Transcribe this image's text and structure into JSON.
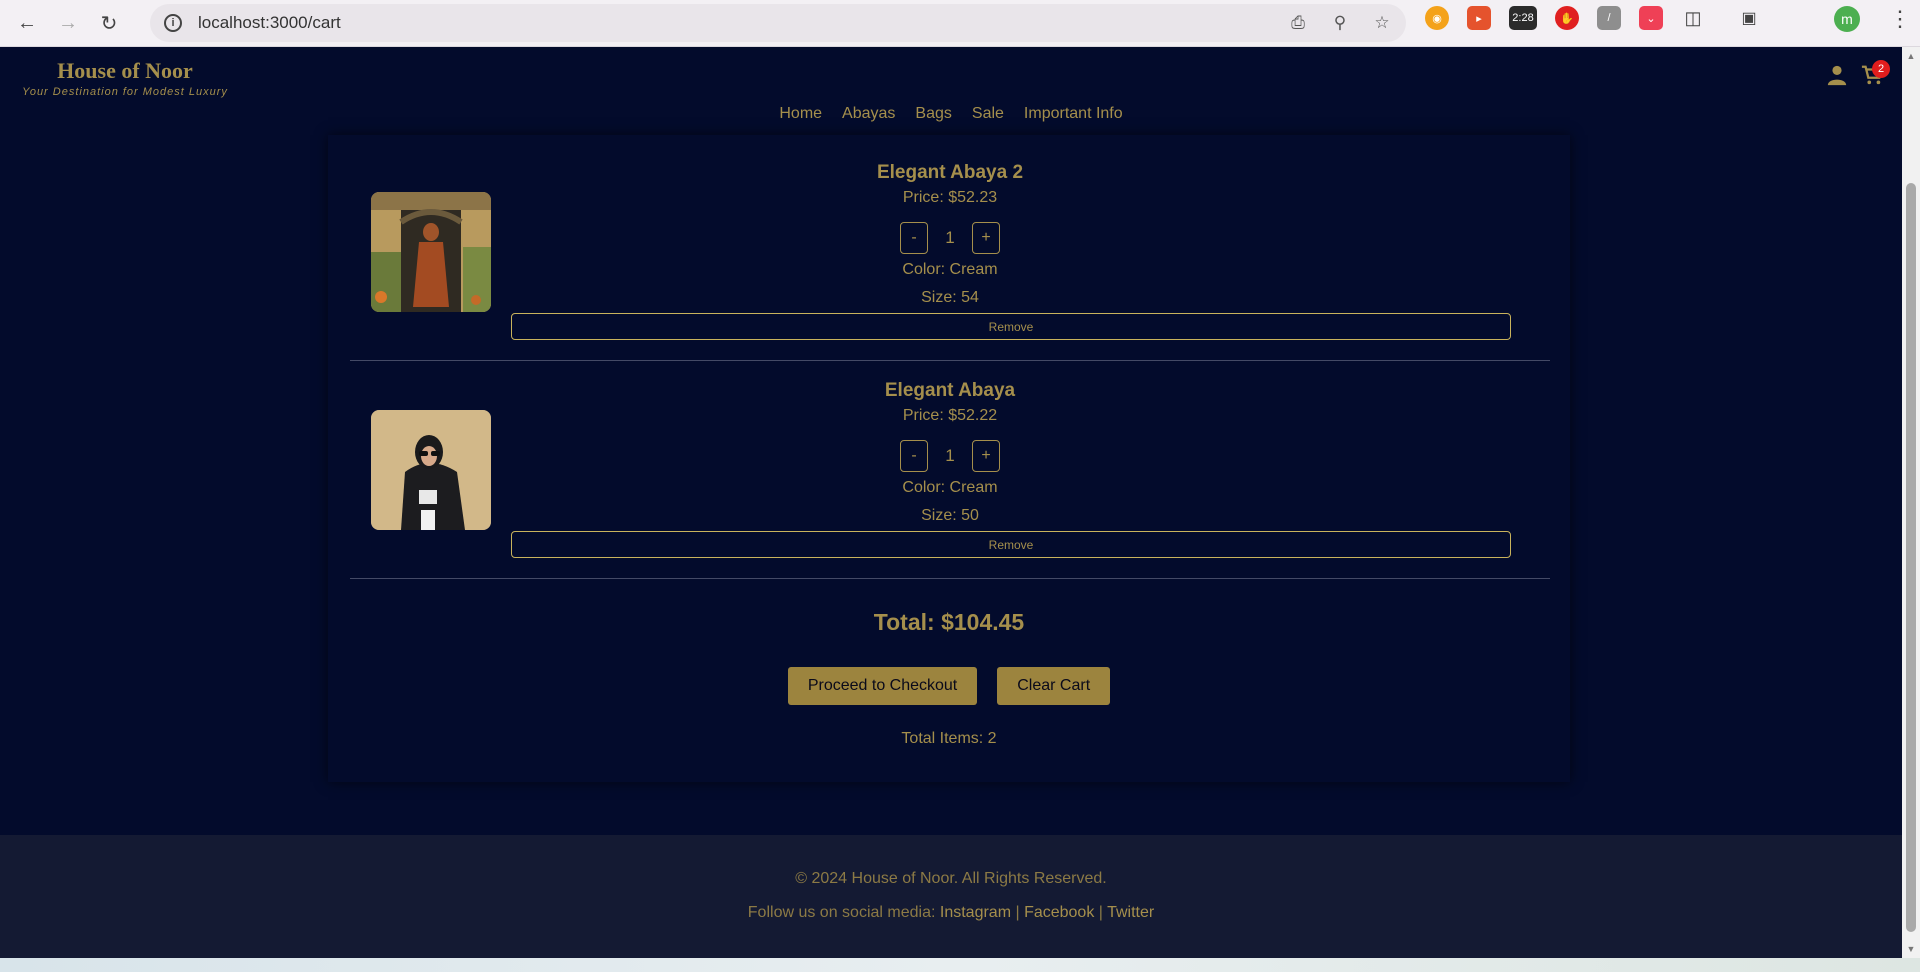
{
  "browser": {
    "url": "localhost:3000/cart",
    "extension_time": "2:28",
    "profile_initial": "m"
  },
  "header": {
    "brand": "House of Noor",
    "tagline": "Your Destination for Modest Luxury",
    "cart_count": "2",
    "nav": [
      "Home",
      "Abayas",
      "Bags",
      "Sale",
      "Important Info"
    ]
  },
  "cart": {
    "items": [
      {
        "title": "Elegant Abaya 2",
        "price": "Price: $52.23",
        "quantity": "1",
        "color": "Color: Cream",
        "size": "Size: 54",
        "remove_label": "Remove",
        "minus_label": "-",
        "plus_label": "+"
      },
      {
        "title": "Elegant Abaya",
        "price": "Price: $52.22",
        "quantity": "1",
        "color": "Color: Cream",
        "size": "Size: 50",
        "remove_label": "Remove",
        "minus_label": "-",
        "plus_label": "+"
      }
    ],
    "total": "Total: $104.45",
    "checkout_label": "Proceed to Checkout",
    "clear_label": "Clear Cart",
    "total_items": "Total Items: 2"
  },
  "footer": {
    "copyright": "© 2024 House of Noor. All Rights Reserved.",
    "social_prefix": "Follow us on social media: ",
    "instagram": "Instagram",
    "facebook": "Facebook",
    "twitter": "Twitter",
    "separator": " | "
  },
  "colors": {
    "page_bg": "#030b2c",
    "gold": "#a58f4c",
    "button_gold": "#9c843e",
    "footer_bg": "#141a33",
    "badge_red": "#e11d1d"
  }
}
